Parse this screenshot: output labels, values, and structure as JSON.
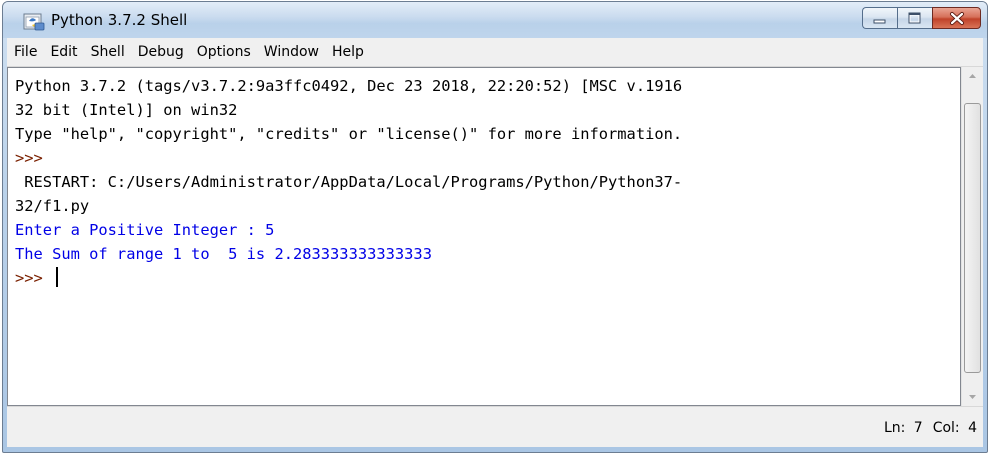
{
  "window": {
    "title": "Python 3.7.2 Shell",
    "app_icon": "python-idle-icon",
    "caption_buttons": [
      "minimize-icon",
      "maximize-icon",
      "close-icon"
    ]
  },
  "menubar": {
    "items": [
      "File",
      "Edit",
      "Shell",
      "Debug",
      "Options",
      "Window",
      "Help"
    ]
  },
  "shell": {
    "lines": [
      {
        "text": "Python 3.7.2 (tags/v3.7.2:9a3ffc0492, Dec 23 2018, 22:20:52) [MSC v.1916",
        "style": "normal"
      },
      {
        "text": "32 bit (Intel)] on win32",
        "style": "normal"
      },
      {
        "text": "Type \"help\", \"copyright\", \"credits\" or \"license()\" for more information.",
        "style": "normal"
      },
      {
        "text": ">>>",
        "style": "prompt"
      },
      {
        "text": " RESTART: C:/Users/Administrator/AppData/Local/Programs/Python/Python37-",
        "style": "normal"
      },
      {
        "text": "32/f1.py",
        "style": "normal"
      },
      {
        "text": "Enter a Positive Integer : 5",
        "style": "output"
      },
      {
        "text": "The Sum of range 1 to  5 is 2.283333333333333",
        "style": "output"
      },
      {
        "text": ">>> ",
        "style": "prompt"
      }
    ]
  },
  "statusbar": {
    "line": "Ln: 7",
    "col": "Col: 4"
  },
  "colors": {
    "prompt": "#7a2000",
    "output": "#0000e6",
    "title_gradient_top": "#e3edf8",
    "close_button": "#c0422a"
  }
}
